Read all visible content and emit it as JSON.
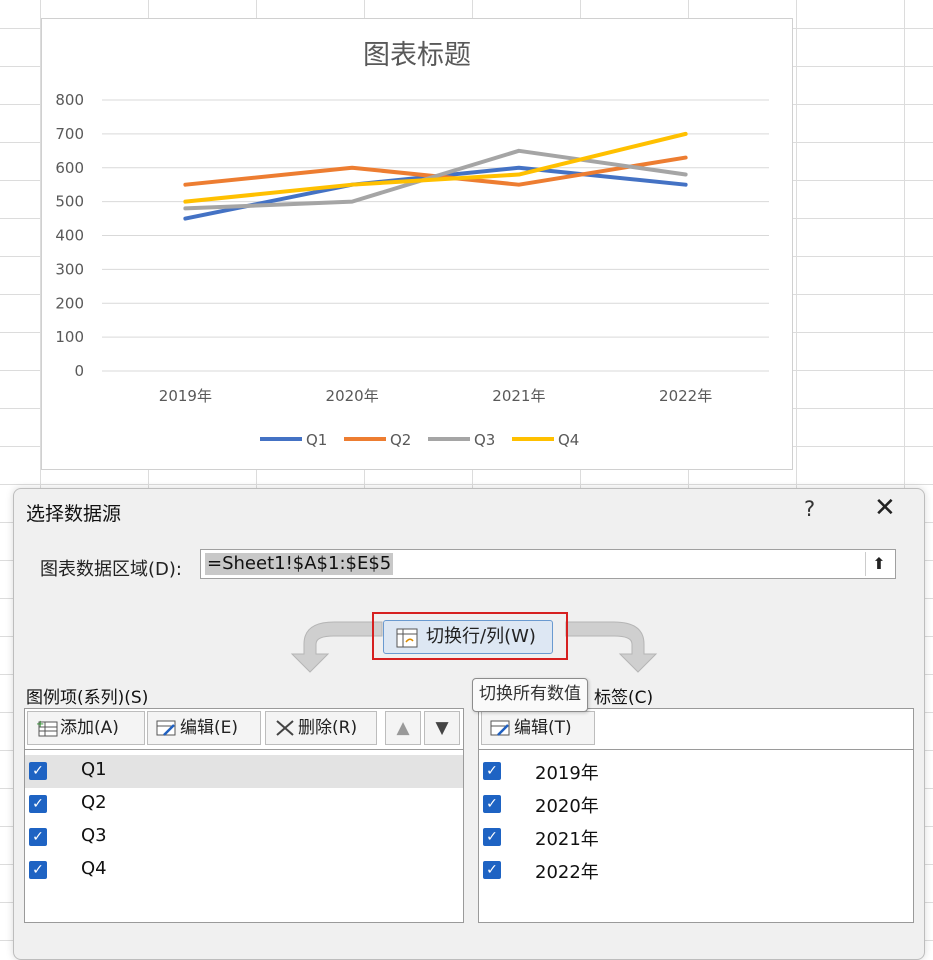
{
  "chart_data": {
    "type": "line",
    "title": "图表标题",
    "categories": [
      "2019年",
      "2020年",
      "2021年",
      "2022年"
    ],
    "series": [
      {
        "name": "Q1",
        "color": "#4472C4",
        "values": [
          450,
          550,
          600,
          550
        ]
      },
      {
        "name": "Q2",
        "color": "#ED7D31",
        "values": [
          550,
          600,
          550,
          630
        ]
      },
      {
        "name": "Q3",
        "color": "#A5A5A5",
        "values": [
          480,
          500,
          650,
          580
        ]
      },
      {
        "name": "Q4",
        "color": "#FFC000",
        "values": [
          500,
          550,
          580,
          700
        ]
      }
    ],
    "ylim": [
      0,
      800
    ],
    "yticks": [
      0,
      100,
      200,
      300,
      400,
      500,
      600,
      700,
      800
    ],
    "grid": true,
    "legend": "bottom"
  },
  "dialog": {
    "title": "选择数据源",
    "help": "?",
    "close": "✕",
    "range_label": "图表数据区域(D):",
    "range_value": "=Sheet1!$A$1:$E$5",
    "range_btn": "⬆",
    "switch_label": "切换行/列(W)",
    "tooltip": "切换所有数值",
    "legend_section": "图例项(系列)(S)",
    "axis_section_visible": "标签(C)",
    "legend_toolbar": {
      "add": "添加(A)",
      "edit": "编辑(E)",
      "delete": "删除(R)",
      "up": "▲",
      "down": "▼"
    },
    "axis_toolbar": {
      "edit": "编辑(T)"
    },
    "series_items": [
      "Q1",
      "Q2",
      "Q3",
      "Q4"
    ],
    "category_items": [
      "2019年",
      "2020年",
      "2021年",
      "2022年"
    ],
    "check": "✓"
  }
}
